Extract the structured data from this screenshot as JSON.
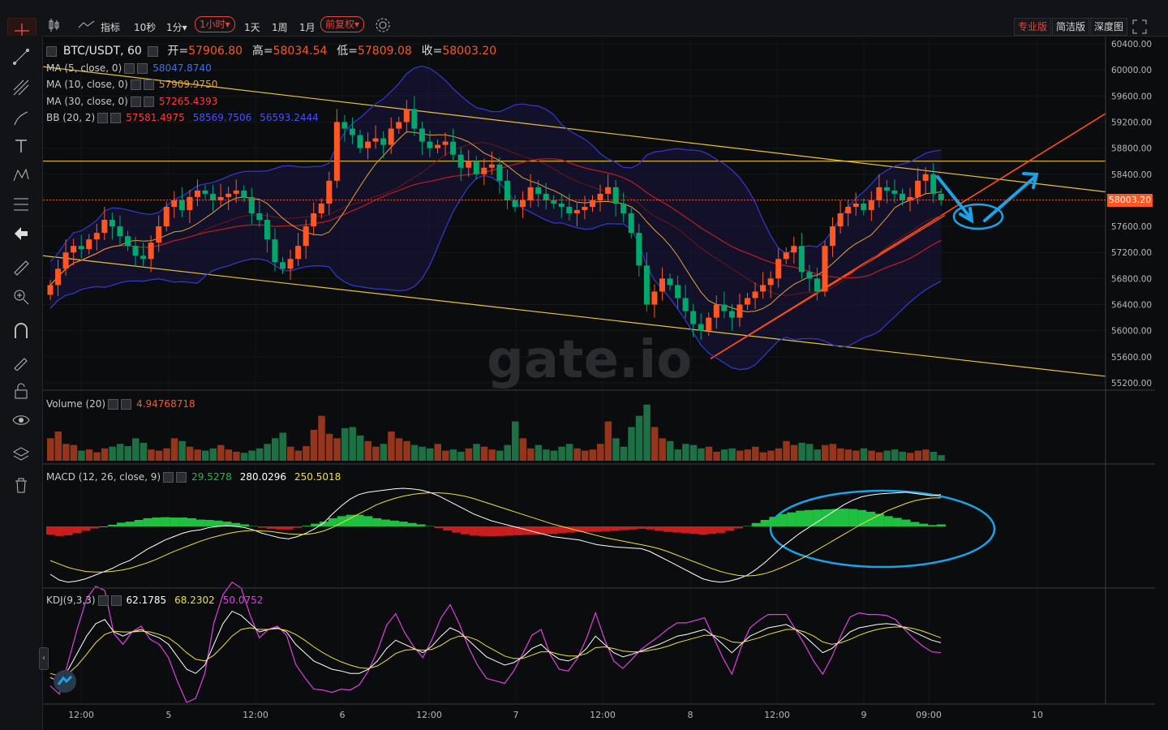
{
  "toolbar": {
    "indicators_label": "指标",
    "intervals": [
      "10秒",
      "1分▾",
      "1小时▾",
      "1天",
      "1周",
      "1月"
    ],
    "active_interval_index": 2,
    "adjust_label": "前复权▾",
    "views": [
      "专业版",
      "简洁版",
      "深度图"
    ],
    "active_view_index": 0
  },
  "legend": {
    "pair": "BTC/USDT, 60",
    "open_label": "开=",
    "open": "57906.80",
    "high_label": "高=",
    "high": "58034.54",
    "low_label": "低=",
    "low": "57809.08",
    "close_label": "收=",
    "close": "58003.20",
    "ma5_label": "MA (5, close, 0)",
    "ma5": "58047.8740",
    "ma10_label": "MA (10, close, 0)",
    "ma10": "57909.9750",
    "ma30_label": "MA (30, close, 0)",
    "ma30": "57265.4393",
    "bb_label": "BB (20, 2)",
    "bb_mid": "57581.4975",
    "bb_up": "58569.7506",
    "bb_low": "56593.2444",
    "volume_label": "Volume (20)",
    "volume": "4.94768718",
    "macd_label": "MACD (12, 26, close, 9)",
    "macd_hist": "29.5278",
    "macd_dif": "280.0296",
    "macd_dea": "250.5018",
    "kdj_label": "KDJ(9,3,3)",
    "kdj_k": "62.1785",
    "kdj_d": "68.2302",
    "kdj_j": "50.0752"
  },
  "watermark": "gate.io",
  "price_tag": "58003.20",
  "colors": {
    "up": "#ff5722",
    "down": "#00a86b",
    "ma5": "#ffffff",
    "ma10": "#e3a13d",
    "ma30": "#b51d1d",
    "bb": "#3237c8",
    "trend": "#e8c23a",
    "support": "#ff4d1a",
    "annotation": "#1aa3e8"
  },
  "chart_data": [
    {
      "type": "candlestick",
      "y_ticks": [
        "60400.00",
        "60000.00",
        "59600.00",
        "59200.00",
        "58800.00",
        "58400.00",
        "58000.00",
        "57600.00",
        "57200.00",
        "56800.00",
        "56400.00",
        "56000.00",
        "55600.00",
        "55200.00"
      ],
      "ylim": [
        55100,
        60500
      ],
      "x_ticks": [
        "12:00",
        "5",
        "12:00",
        "6",
        "12:00",
        "7",
        "12:00",
        "8",
        "12:00",
        "9",
        "09:00",
        "10"
      ],
      "current_price": 58003.2,
      "closes": [
        56700,
        56950,
        57200,
        57300,
        57250,
        57400,
        57500,
        57700,
        57600,
        57450,
        57300,
        57150,
        57100,
        57350,
        57600,
        57900,
        58000,
        57850,
        58050,
        58150,
        58100,
        58000,
        58050,
        58100,
        58150,
        58050,
        57800,
        57700,
        57400,
        57050,
        56950,
        57100,
        57300,
        57600,
        57800,
        57950,
        58300,
        59200,
        59100,
        59000,
        58800,
        58900,
        58950,
        58850,
        59100,
        59200,
        59400,
        59100,
        58900,
        58800,
        58850,
        58900,
        58700,
        58500,
        58600,
        58400,
        58500,
        58550,
        58300,
        58000,
        57900,
        58000,
        58200,
        58100,
        58000,
        57950,
        57900,
        57800,
        57850,
        57900,
        58000,
        58100,
        58200,
        57950,
        57800,
        57500,
        57000,
        56400,
        56600,
        56800,
        56700,
        56500,
        56300,
        56100,
        56000,
        56200,
        56400,
        56300,
        56200,
        56400,
        56500,
        56600,
        56700,
        56800,
        57100,
        57200,
        57300,
        56900,
        56800,
        56600,
        57300,
        57600,
        57800,
        57900,
        57950,
        57850,
        58000,
        58200,
        58150,
        58100,
        58000,
        58050,
        58300,
        58400,
        58100,
        58003
      ],
      "volume_ticks": [
        "100",
        "0"
      ],
      "volume_max": 120,
      "volumes": [
        40,
        52,
        30,
        28,
        18,
        20,
        15,
        22,
        25,
        30,
        26,
        40,
        32,
        20,
        18,
        22,
        40,
        35,
        25,
        20,
        18,
        22,
        28,
        20,
        16,
        14,
        18,
        22,
        30,
        40,
        50,
        25,
        18,
        26,
        55,
        80,
        48,
        40,
        58,
        60,
        45,
        35,
        25,
        30,
        52,
        40,
        35,
        28,
        25,
        22,
        30,
        18,
        20,
        16,
        22,
        30,
        25,
        20,
        18,
        28,
        70,
        40,
        22,
        28,
        20,
        18,
        25,
        30,
        22,
        18,
        20,
        30,
        70,
        40,
        25,
        60,
        80,
        100,
        60,
        40,
        35,
        20,
        30,
        28,
        22,
        25,
        16,
        20,
        22,
        18,
        20,
        25,
        15,
        18,
        22,
        35,
        28,
        32,
        30,
        20,
        28,
        30,
        22,
        20,
        18,
        22,
        18,
        15,
        18,
        20,
        16,
        14,
        18,
        20,
        16,
        10
      ],
      "macd_ticks": [
        "500.0000",
        "250.0000",
        "0.0000",
        "-250.0000",
        "-500.0000"
      ],
      "macd_range": [
        -520,
        520
      ],
      "macd_dif": [
        -420,
        -470,
        -490,
        -480,
        -460,
        -430,
        -400,
        -370,
        -330,
        -300,
        -250,
        -200,
        -160,
        -120,
        -90,
        -60,
        -40,
        -30,
        -10,
        0,
        5,
        0,
        -10,
        -30,
        -60,
        -80,
        -100,
        -110,
        -90,
        -60,
        -20,
        30,
        110,
        180,
        240,
        280,
        300,
        310,
        320,
        330,
        335,
        330,
        320,
        300,
        270,
        230,
        190,
        150,
        110,
        80,
        50,
        30,
        10,
        -10,
        -30,
        -50,
        -70,
        -90,
        -100,
        -110,
        -120,
        -140,
        -160,
        -170,
        -180,
        -185,
        -190,
        -195,
        -220,
        -260,
        -300,
        -340,
        -380,
        -420,
        -460,
        -480,
        -490,
        -480,
        -460,
        -430,
        -380,
        -320,
        -250,
        -180,
        -120,
        -60,
        -10,
        40,
        90,
        140,
        190,
        230,
        260,
        275,
        285,
        290,
        295,
        300,
        290,
        280,
        270,
        280
      ],
      "macd_dea": [
        -300,
        -330,
        -360,
        -380,
        -395,
        -400,
        -400,
        -395,
        -385,
        -370,
        -345,
        -320,
        -290,
        -255,
        -220,
        -190,
        -160,
        -130,
        -105,
        -85,
        -65,
        -50,
        -40,
        -35,
        -40,
        -45,
        -55,
        -65,
        -70,
        -70,
        -60,
        -40,
        -10,
        30,
        70,
        110,
        150,
        190,
        220,
        245,
        265,
        280,
        290,
        295,
        295,
        290,
        280,
        265,
        245,
        220,
        195,
        170,
        145,
        120,
        95,
        70,
        45,
        20,
        0,
        -20,
        -40,
        -60,
        -80,
        -100,
        -115,
        -130,
        -145,
        -160,
        -175,
        -195,
        -220,
        -250,
        -280,
        -310,
        -340,
        -370,
        -395,
        -415,
        -430,
        -435,
        -430,
        -415,
        -390,
        -360,
        -325,
        -290,
        -250,
        -205,
        -160,
        -115,
        -70,
        -25,
        20,
        60,
        100,
        140,
        170,
        200,
        225,
        240,
        250,
        250
      ],
      "kdj_ticks": [
        "120.0000",
        "80.0000",
        "40.0000",
        "0.0000"
      ],
      "kdj_range": [
        -10,
        125
      ],
      "kdj_k": [
        20,
        15,
        30,
        50,
        70,
        85,
        90,
        75,
        70,
        75,
        78,
        72,
        68,
        60,
        45,
        30,
        25,
        35,
        60,
        85,
        100,
        95,
        85,
        75,
        78,
        80,
        75,
        60,
        50,
        40,
        35,
        30,
        28,
        25,
        25,
        30,
        40,
        55,
        65,
        60,
        55,
        50,
        58,
        70,
        80,
        75,
        65,
        55,
        45,
        40,
        35,
        38,
        45,
        55,
        60,
        50,
        42,
        40,
        45,
        55,
        70,
        60,
        50,
        45,
        48,
        52,
        56,
        60,
        65,
        70,
        72,
        75,
        78,
        70,
        60,
        50,
        60,
        70,
        75,
        80,
        82,
        84,
        78,
        70,
        60,
        50,
        55,
        65,
        75,
        80,
        82,
        84,
        85,
        84,
        80,
        75,
        70,
        65,
        62
      ],
      "kdj_d": [
        25,
        22,
        25,
        35,
        48,
        62,
        72,
        76,
        75,
        75,
        76,
        75,
        72,
        68,
        60,
        50,
        42,
        40,
        47,
        58,
        70,
        78,
        80,
        78,
        78,
        79,
        77,
        72,
        65,
        57,
        50,
        44,
        39,
        35,
        32,
        31,
        34,
        41,
        49,
        53,
        54,
        53,
        54,
        59,
        66,
        70,
        69,
        65,
        58,
        52,
        46,
        43,
        43,
        47,
        51,
        51,
        48,
        46,
        46,
        49,
        56,
        57,
        55,
        52,
        51,
        51,
        53,
        55,
        58,
        62,
        65,
        68,
        71,
        71,
        68,
        63,
        62,
        65,
        68,
        72,
        75,
        78,
        78,
        75,
        70,
        63,
        60,
        62,
        66,
        71,
        75,
        78,
        80,
        81,
        81,
        79,
        76,
        72,
        68
      ],
      "kdj_j": [
        10,
        0,
        40,
        80,
        115,
        130,
        125,
        73,
        60,
        75,
        82,
        66,
        60,
        44,
        15,
        -10,
        -5,
        25,
        86,
        120,
        135,
        128,
        95,
        68,
        78,
        82,
        71,
        36,
        20,
        6,
        5,
        2,
        6,
        5,
        11,
        28,
        52,
        83,
        97,
        74,
        57,
        44,
        66,
        92,
        108,
        85,
        57,
        35,
        19,
        16,
        13,
        28,
        49,
        71,
        78,
        48,
        30,
        28,
        43,
        67,
        98,
        66,
        40,
        31,
        42,
        54,
        62,
        70,
        79,
        86,
        86,
        89,
        92,
        68,
        44,
        24,
        56,
        80,
        89,
        96,
        96,
        96,
        78,
        60,
        40,
        24,
        45,
        71,
        93,
        98,
        96,
        96,
        95,
        90,
        78,
        67,
        58,
        51,
        50
      ]
    }
  ]
}
